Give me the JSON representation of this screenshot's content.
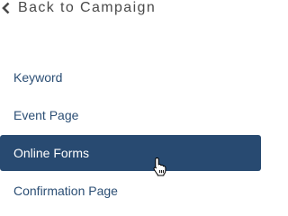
{
  "back": {
    "label": "Back to Campaign",
    "icon": "chevron-left-icon"
  },
  "nav": {
    "items": [
      {
        "label": "Keyword",
        "active": false
      },
      {
        "label": "Event Page",
        "active": false
      },
      {
        "label": "Online Forms",
        "active": true
      },
      {
        "label": "Confirmation Page",
        "active": false
      }
    ]
  },
  "colors": {
    "active_background": "#284a71",
    "link_text": "#2b4e74",
    "back_text": "#4a4a4a"
  },
  "cursor": {
    "icon": "hand-pointer-icon"
  }
}
